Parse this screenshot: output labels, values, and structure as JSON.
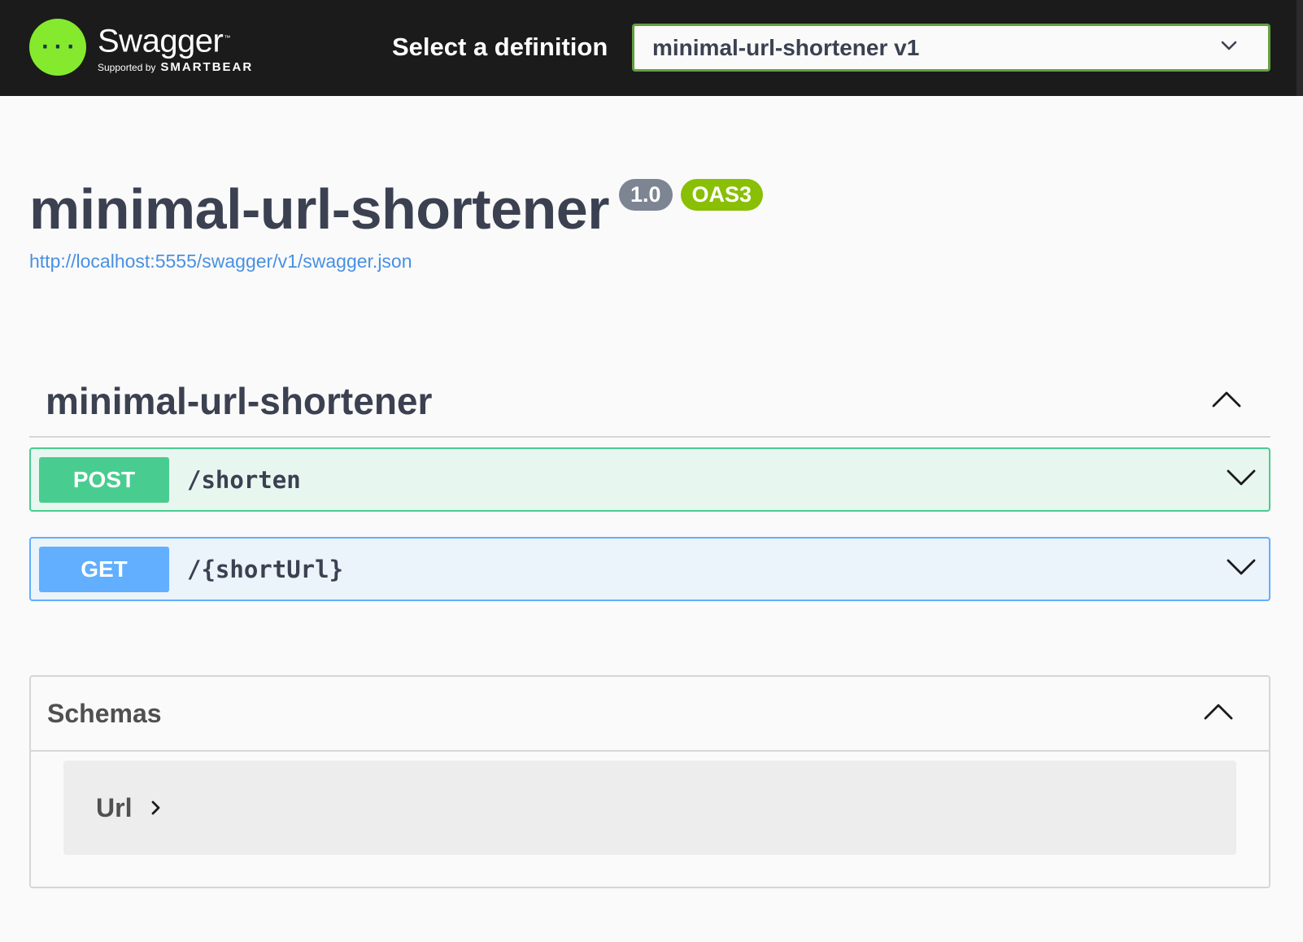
{
  "topbar": {
    "brand_name": "Swagger",
    "brand_supported_by": "Supported by",
    "brand_company": "SMARTBEAR",
    "definition_label": "Select a definition",
    "definition_selected": "minimal-url-shortener v1"
  },
  "info": {
    "title": "minimal-url-shortener",
    "version": "1.0",
    "oas_badge": "OAS3",
    "spec_url": "http://localhost:5555/swagger/v1/swagger.json"
  },
  "tag": {
    "name": "minimal-url-shortener"
  },
  "operations": [
    {
      "method": "POST",
      "path": "/shorten"
    },
    {
      "method": "GET",
      "path": "/{shortUrl}"
    }
  ],
  "schemas": {
    "title": "Schemas",
    "models": [
      {
        "name": "Url"
      }
    ]
  },
  "colors": {
    "topbar_bg": "#1b1b1b",
    "logo_green": "#85ea2d",
    "select_border": "#62a03f",
    "post": "#49cc90",
    "get": "#61affe",
    "version_badge": "#7d8492",
    "oas_badge": "#89bf04",
    "link": "#4990e2"
  },
  "icons": {
    "logo": "swagger-braces-icon",
    "select_arrow": "chevron-down-icon",
    "tag_toggle": "chevron-up-icon",
    "op_toggle": "chevron-down-icon",
    "schemas_toggle": "chevron-up-icon",
    "model_toggle": "chevron-right-icon"
  }
}
